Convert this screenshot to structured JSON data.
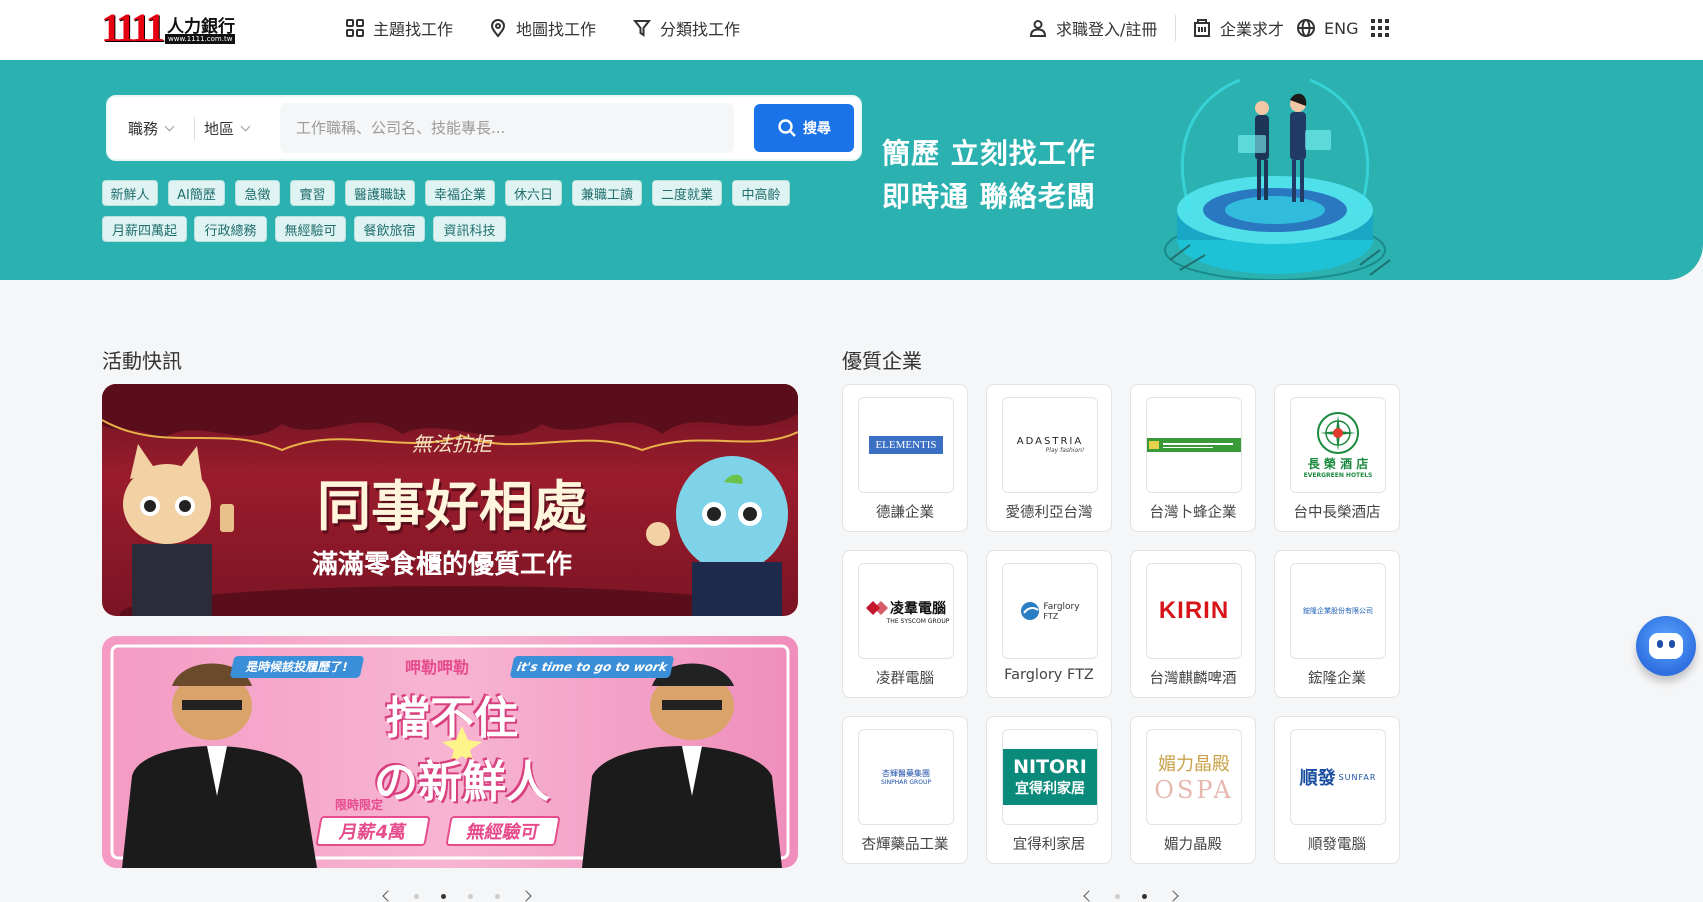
{
  "header": {
    "logo_digits": "1111",
    "logo_name": "人力銀行",
    "logo_url": "www.1111.com.tw",
    "nav": {
      "theme_jobs": "主題找工作",
      "map_jobs": "地圖找工作",
      "category_jobs": "分類找工作",
      "login": "求職登入/註冊",
      "employer": "企業求才",
      "language": "ENG"
    }
  },
  "search": {
    "job_select": "職務",
    "area_select": "地區",
    "placeholder": "工作職稱、公司名、技能專長...",
    "button_label": "搜尋"
  },
  "tags": [
    "新鮮人",
    "AI簡歷",
    "急徵",
    "實習",
    "醫護職缺",
    "幸福企業",
    "休六日",
    "兼職工讀",
    "二度就業",
    "中高齡",
    "月薪四萬起",
    "行政總務",
    "無經驗可",
    "餐飲旅宿",
    "資訊科技"
  ],
  "slogan": {
    "line1": "簡歷 立刻找工作",
    "line2": "即時通 聯絡老闆"
  },
  "events": {
    "title": "活動快訊",
    "banner1": {
      "tagline": "無法抗拒",
      "headline": "同事好相處",
      "subline": "滿滿零食櫃的優質工作"
    },
    "banner2": {
      "bubble_left": "是時候該投履歷了!",
      "bubble_mid": "呷勒呷勒",
      "bubble_right": "it's time to go to work",
      "headline1": "擋不住",
      "headline2": "の新鮮人",
      "limited": "限時限定",
      "salary": "月薪4萬",
      "no_exp": "無經驗可"
    }
  },
  "companies": {
    "title": "優質企業",
    "items": [
      {
        "name": "德謙企業",
        "logo_text": "ELEMENTIS",
        "logo_color": "#3a6fc4"
      },
      {
        "name": "愛德利亞台灣",
        "logo_text": "ADASTRIA",
        "logo_sub": "Play fashion!",
        "logo_color": "#222222"
      },
      {
        "name": "台灣卜蜂企業",
        "logo_text": "",
        "logo_color": "#3a9a3a"
      },
      {
        "name": "台中長榮酒店",
        "logo_text": "長 榮 酒 店",
        "logo_sub": "EVERGREEN HOTELS",
        "logo_color": "#1b8a3e"
      },
      {
        "name": "凌群電腦",
        "logo_text": "凌羣電腦",
        "logo_sub": "THE SYSCOM GROUP",
        "logo_color": "#c4162a"
      },
      {
        "name": "Farglory FTZ",
        "logo_text": "Farglory",
        "logo_sub": "FTZ",
        "logo_color": "#2a7fc4"
      },
      {
        "name": "台灣麒麟啤酒",
        "logo_text": "KIRIN",
        "logo_color": "#d7141a"
      },
      {
        "name": "鋐隆企業",
        "logo_text": "鋐隆企業股份有限公司",
        "logo_color": "#1d5fb4"
      },
      {
        "name": "杏輝藥品工業",
        "logo_text": "杏輝醫藥集團",
        "logo_sub": "SINPHAR GROUP",
        "logo_color": "#1d4fa8"
      },
      {
        "name": "宜得利家居",
        "logo_text": "NITORI",
        "logo_sub": "宜得利家居",
        "logo_color": "#0a8a7a"
      },
      {
        "name": "媚力晶殿",
        "logo_text": "媚力晶殿",
        "logo_sub": "OSPA",
        "logo_color": "#c9a24a"
      },
      {
        "name": "順發電腦",
        "logo_text": "順發",
        "logo_sub": "SUNFAR",
        "logo_color": "#1a4fa0"
      }
    ]
  },
  "colors": {
    "hero": "#2bb1b0",
    "accent": "#1a73e8",
    "brand_red": "#e60012"
  },
  "icons": {
    "theme": "grid-squares-icon",
    "map": "map-pin-icon",
    "category": "filter-icon",
    "login": "user-icon",
    "employer": "building-icon",
    "language": "globe-icon",
    "apps": "apps-grid-icon",
    "search": "search-icon",
    "chatbot": "robot-icon"
  }
}
